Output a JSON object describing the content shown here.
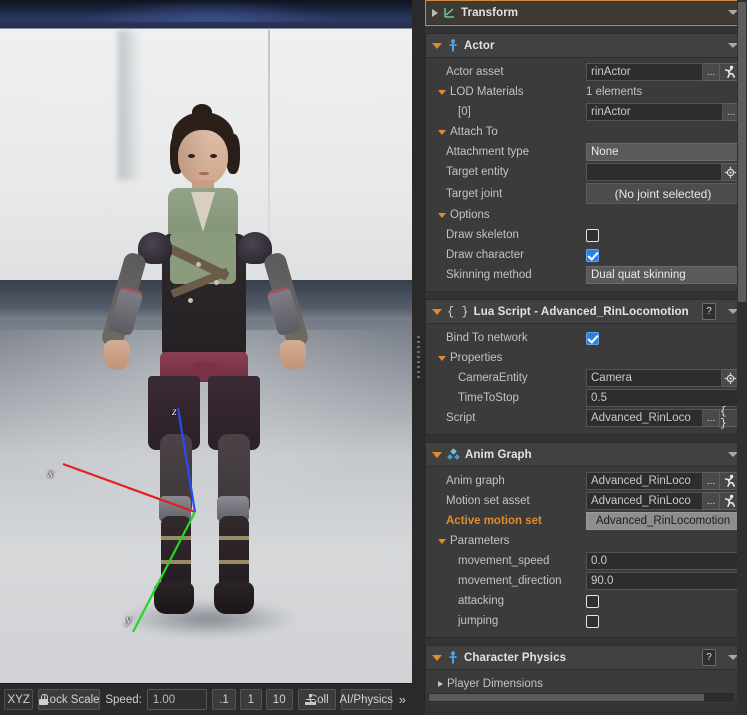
{
  "viewport": {
    "gizmo": {
      "x_label": "x",
      "y_label": "y",
      "z_label": "z",
      "x_color": "#e02020",
      "y_color": "#22d822",
      "z_color": "#2a4cf0"
    },
    "toolbar": {
      "space_button": "XYZ",
      "lock_scale_button": "Lock Scale",
      "speed_label": "Speed:",
      "speed_value": "1.00",
      "preset_1": ".1",
      "preset_2": "1",
      "preset_3": "10",
      "collision_button": "Coll",
      "ai_physics_button": "AI/Physics",
      "overflow_button": "»"
    }
  },
  "inspector": {
    "cards": [
      {
        "id": "transform",
        "title": "Transform",
        "icon": "transform-icon",
        "collapsed": true,
        "highlighted": true,
        "has_help": false
      },
      {
        "id": "actor",
        "title": "Actor",
        "icon": "actor-icon",
        "collapsed": false,
        "highlighted": false,
        "has_help": false,
        "rows": [
          {
            "label": "Actor asset",
            "indent": 1,
            "type": "asset",
            "value": "rinActor",
            "browse": "...",
            "icon": "run-man-icon"
          },
          {
            "label": "LOD Materials",
            "indent": 0,
            "type": "group-text",
            "expanded": true,
            "value": "1 elements"
          },
          {
            "label": "[0]",
            "indent": 2,
            "type": "asset-browse",
            "value": "rinActor",
            "browse": "..."
          },
          {
            "label": "Attach To",
            "indent": 0,
            "type": "group",
            "expanded": true
          },
          {
            "label": "Attachment type",
            "indent": 1,
            "type": "combo",
            "value": "None"
          },
          {
            "label": "Target entity",
            "indent": 1,
            "type": "entity",
            "value": "",
            "icon": "target-picker-icon"
          },
          {
            "label": "Target joint",
            "indent": 1,
            "type": "button",
            "value": "(No joint selected)"
          },
          {
            "label": "Options",
            "indent": 0,
            "type": "group",
            "expanded": true
          },
          {
            "label": "Draw skeleton",
            "indent": 1,
            "type": "checkbox",
            "checked": false
          },
          {
            "label": "Draw character",
            "indent": 1,
            "type": "checkbox",
            "checked": true
          },
          {
            "label": "Skinning method",
            "indent": 1,
            "type": "combo",
            "value": "Dual quat skinning"
          }
        ]
      },
      {
        "id": "lua-script",
        "title": "{ } Lua Script - Advanced_RinLocomotion",
        "title_text": "Lua Script - Advanced_RinLocomotion",
        "icon": "lua-braces-icon",
        "collapsed": false,
        "highlighted": false,
        "has_help": true,
        "help_label": "?",
        "rows": [
          {
            "label": "Bind To network",
            "indent": 1,
            "type": "checkbox",
            "checked": true
          },
          {
            "label": "Properties",
            "indent": 0,
            "type": "group",
            "expanded": true
          },
          {
            "label": "CameraEntity",
            "indent": 2,
            "type": "entity",
            "value": "Camera",
            "icon": "target-picker-icon"
          },
          {
            "label": "TimeToStop",
            "indent": 2,
            "type": "text",
            "value": "0.5"
          },
          {
            "label": "Script",
            "indent": 1,
            "type": "asset-script",
            "value": "Advanced_RinLoco",
            "browse": "...",
            "icon": "braces-icon",
            "icon_label": "{ }"
          }
        ]
      },
      {
        "id": "anim-graph",
        "title": "Anim Graph",
        "icon": "anim-graph-icon",
        "collapsed": false,
        "highlighted": false,
        "has_help": false,
        "rows": [
          {
            "label": "Anim graph",
            "indent": 1,
            "type": "asset",
            "value": "Advanced_RinLoco",
            "browse": "...",
            "icon": "run-man-icon"
          },
          {
            "label": "Motion set asset",
            "indent": 1,
            "type": "asset",
            "value": "Advanced_RinLoco",
            "browse": "...",
            "icon": "run-man-icon"
          },
          {
            "label": "Active motion set",
            "indent": 1,
            "type": "combo-light",
            "value": "Advanced_RinLocomotion",
            "label_orange": true
          },
          {
            "label": "Parameters",
            "indent": 0,
            "type": "group",
            "expanded": true
          },
          {
            "label": "movement_speed",
            "indent": 2,
            "type": "text",
            "value": "0.0"
          },
          {
            "label": "movement_direction",
            "indent": 2,
            "type": "text",
            "value": "90.0"
          },
          {
            "label": "attacking",
            "indent": 2,
            "type": "checkbox",
            "checked": false
          },
          {
            "label": "jumping",
            "indent": 2,
            "type": "checkbox",
            "checked": false
          }
        ]
      },
      {
        "id": "character-physics",
        "title": "Character Physics",
        "icon": "actor-icon",
        "collapsed": false,
        "highlighted": false,
        "has_help": true,
        "help_label": "?",
        "rows": [
          {
            "label": "Player Dimensions",
            "indent": 0,
            "type": "group",
            "expanded": false
          }
        ]
      }
    ]
  }
}
